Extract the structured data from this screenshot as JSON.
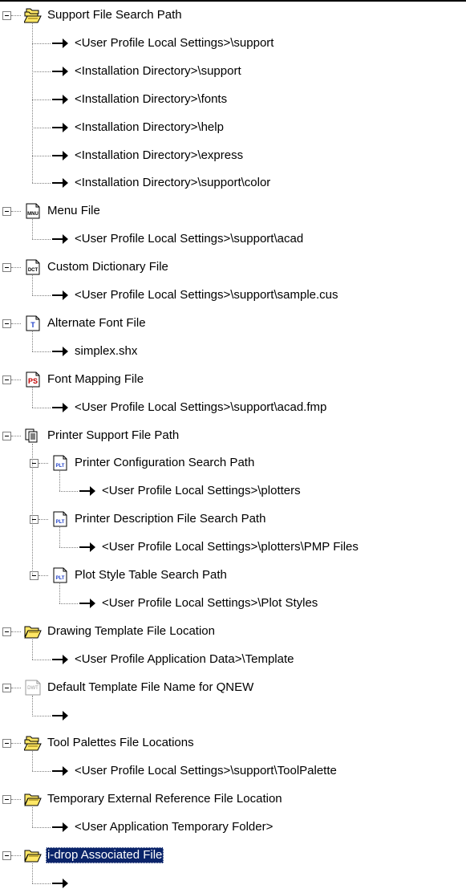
{
  "colors": {
    "selection": "#0a246a",
    "folder_yellow": "#ffe766",
    "tree_lines": "#808080"
  },
  "tree": [
    {
      "label": "Support File Search Path",
      "icon": "multi-folder-icon",
      "expanded": true,
      "children": [
        {
          "label": "<User Profile Local Settings>\\support",
          "icon": "arrow-right-icon"
        },
        {
          "label": "<Installation Directory>\\support",
          "icon": "arrow-right-icon"
        },
        {
          "label": "<Installation Directory>\\fonts",
          "icon": "arrow-right-icon"
        },
        {
          "label": "<Installation Directory>\\help",
          "icon": "arrow-right-icon"
        },
        {
          "label": "<Installation Directory>\\express",
          "icon": "arrow-right-icon"
        },
        {
          "label": "<Installation Directory>\\support\\color",
          "icon": "arrow-right-icon"
        }
      ]
    },
    {
      "label": "Menu File",
      "icon": "menu-file-icon",
      "icon_text": "MNU",
      "expanded": true,
      "children": [
        {
          "label": "<User Profile Local Settings>\\support\\acad",
          "icon": "arrow-right-icon"
        }
      ]
    },
    {
      "label": "Custom Dictionary File",
      "icon": "dictionary-file-icon",
      "icon_text": "DCT",
      "expanded": true,
      "children": [
        {
          "label": "<User Profile Local Settings>\\support\\sample.cus",
          "icon": "arrow-right-icon"
        }
      ]
    },
    {
      "label": "Alternate Font File",
      "icon": "font-file-icon",
      "icon_text": "T",
      "expanded": true,
      "children": [
        {
          "label": "simplex.shx",
          "icon": "arrow-right-icon"
        }
      ]
    },
    {
      "label": "Font Mapping File",
      "icon": "font-mapping-file-icon",
      "icon_text": "PS",
      "expanded": true,
      "children": [
        {
          "label": "<User Profile Local Settings>\\support\\acad.fmp",
          "icon": "arrow-right-icon"
        }
      ]
    },
    {
      "label": "Printer Support File Path",
      "icon": "printer-files-icon",
      "expanded": true,
      "children": [
        {
          "label": "Printer Configuration Search Path",
          "icon": "plot-file-icon",
          "icon_text": "PLT",
          "expanded": true,
          "children": [
            {
              "label": "<User Profile Local Settings>\\plotters",
              "icon": "arrow-right-icon"
            }
          ]
        },
        {
          "label": "Printer Description File Search Path",
          "icon": "plot-file-icon",
          "icon_text": "PLT",
          "expanded": true,
          "children": [
            {
              "label": "<User Profile Local Settings>\\plotters\\PMP Files",
              "icon": "arrow-right-icon"
            }
          ]
        },
        {
          "label": "Plot Style Table Search Path",
          "icon": "plot-file-icon",
          "icon_text": "PLT",
          "expanded": true,
          "children": [
            {
              "label": "<User Profile Local Settings>\\Plot Styles",
              "icon": "arrow-right-icon"
            }
          ]
        }
      ]
    },
    {
      "label": "Drawing Template File Location",
      "icon": "open-folder-icon",
      "expanded": true,
      "children": [
        {
          "label": "<User Profile Application Data>\\Template",
          "icon": "arrow-right-icon"
        }
      ]
    },
    {
      "label": "Default Template File Name for QNEW",
      "icon": "template-file-icon",
      "icon_text": "DWT",
      "expanded": true,
      "children": [
        {
          "label": "",
          "icon": "arrow-right-icon"
        }
      ]
    },
    {
      "label": "Tool Palettes File Locations",
      "icon": "multi-folder-icon",
      "expanded": true,
      "children": [
        {
          "label": "<User Profile Local Settings>\\support\\ToolPalette",
          "icon": "arrow-right-icon"
        }
      ]
    },
    {
      "label": "Temporary External Reference File Location",
      "icon": "open-folder-icon",
      "expanded": true,
      "children": [
        {
          "label": "<User Application Temporary Folder>",
          "icon": "arrow-right-icon"
        }
      ]
    },
    {
      "label": "i-drop Associated File",
      "icon": "open-folder-icon",
      "expanded": true,
      "selected": true,
      "children": [
        {
          "label": "",
          "icon": "arrow-right-icon"
        }
      ]
    }
  ]
}
